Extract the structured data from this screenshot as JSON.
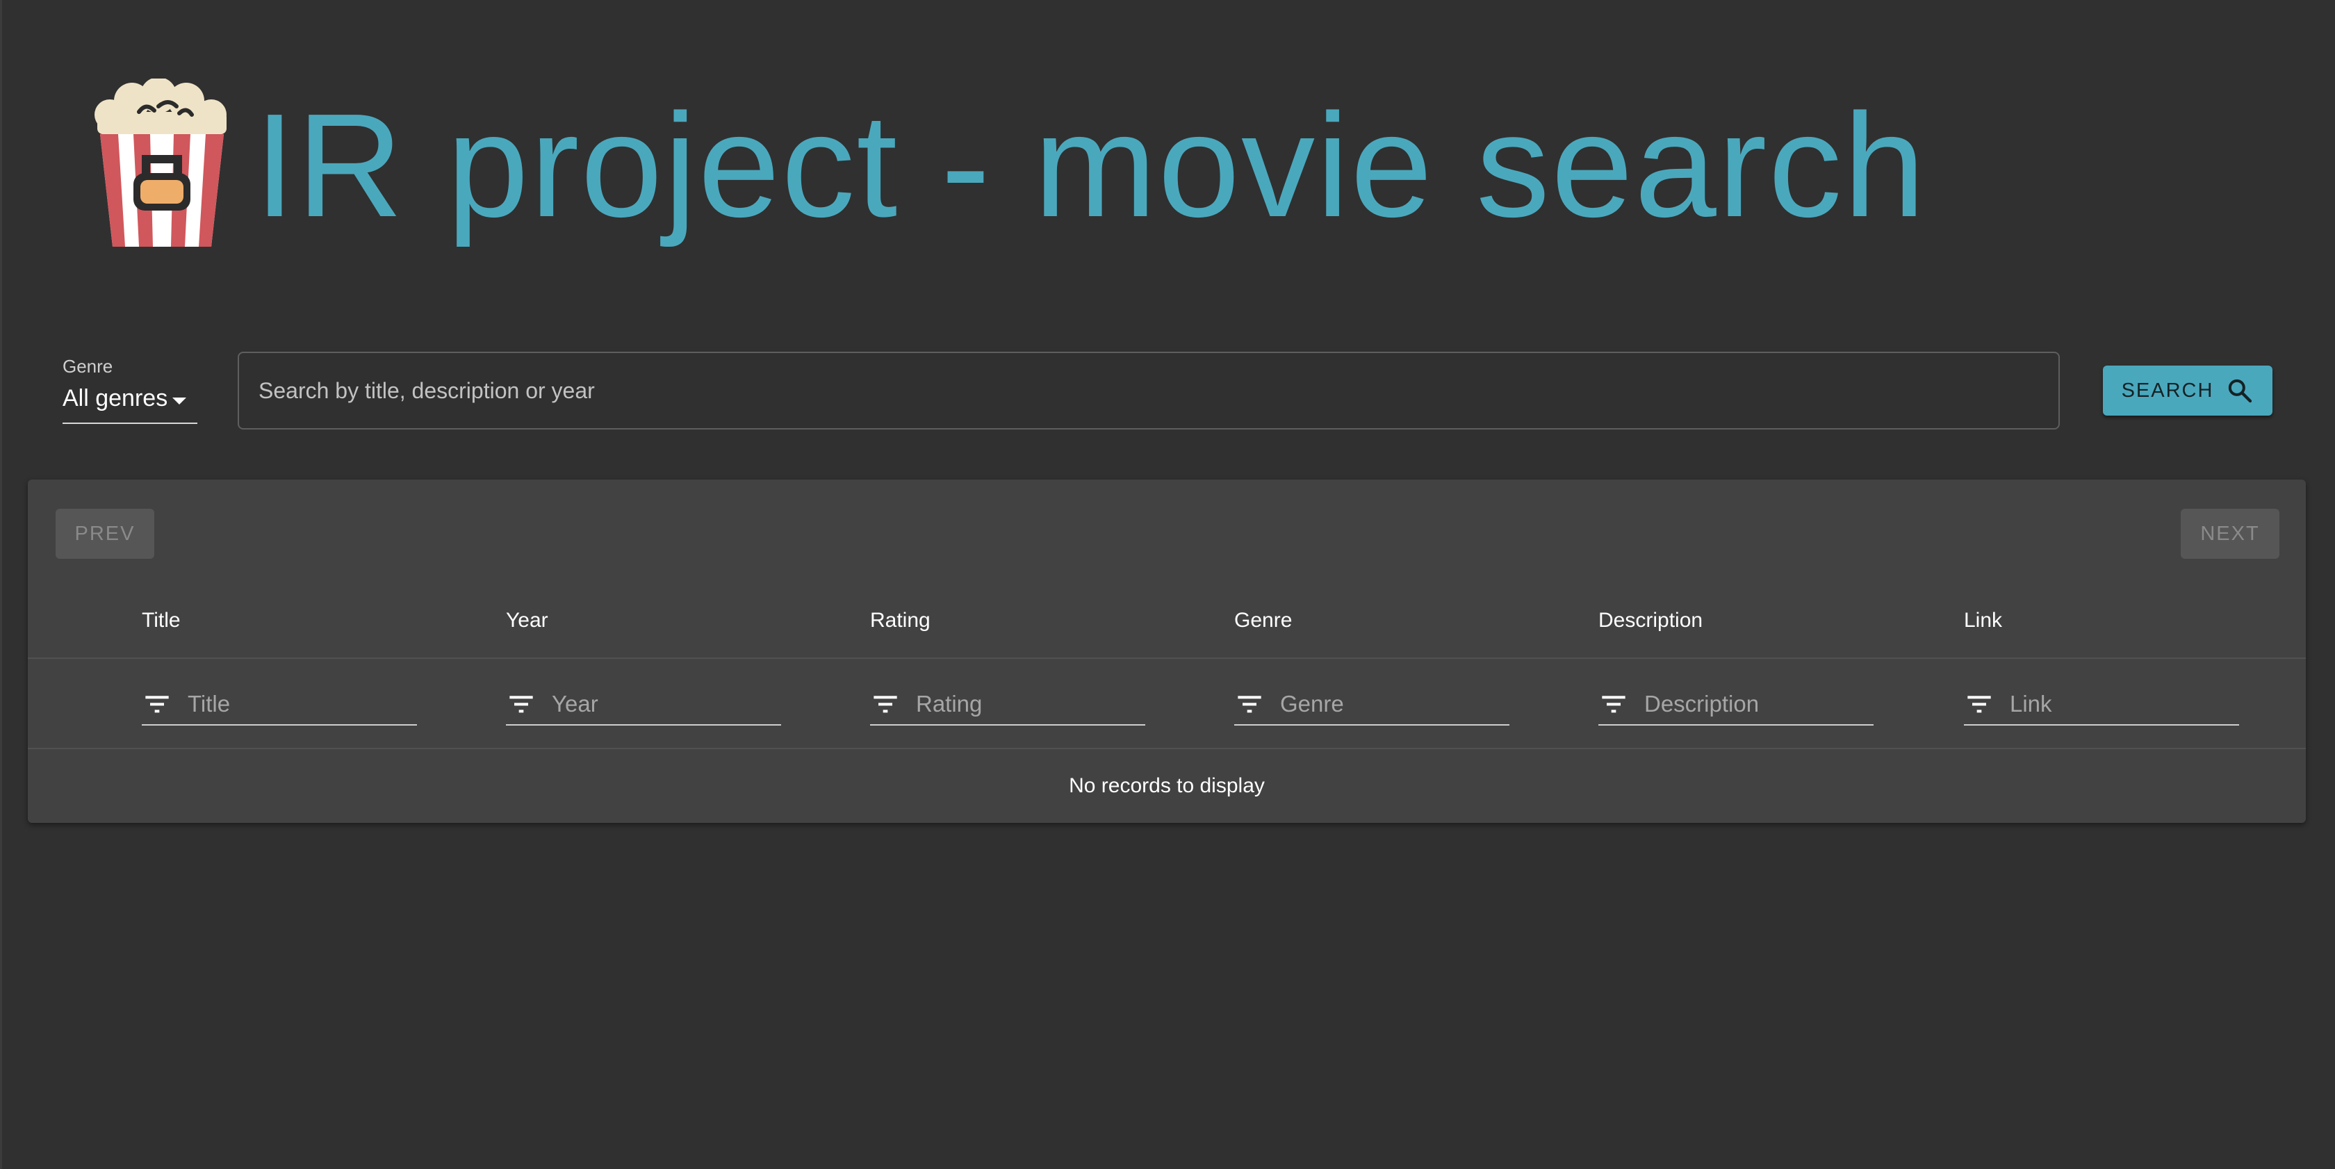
{
  "header": {
    "title": "IR project - movie search"
  },
  "genre_select": {
    "label": "Genre",
    "value": "All genres"
  },
  "search": {
    "placeholder": "Search by title, description or year",
    "value": "",
    "button_label": "SEARCH"
  },
  "pagination": {
    "prev_label": "PREV",
    "next_label": "NEXT"
  },
  "table": {
    "columns": [
      "Title",
      "Year",
      "Rating",
      "Genre",
      "Description",
      "Link"
    ],
    "filter_placeholders": [
      "Title",
      "Year",
      "Rating",
      "Genre",
      "Description",
      "Link"
    ],
    "empty_message": "No records to display",
    "rows": []
  },
  "colors": {
    "accent": "#4aa8bd",
    "background": "#303030",
    "card": "#424242"
  },
  "icons": {
    "logo": "popcorn-icon",
    "search": "search-icon",
    "filter": "filter-list-icon",
    "dropdown": "caret-down-icon"
  }
}
